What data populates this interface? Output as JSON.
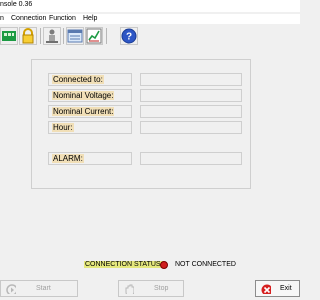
{
  "window": {
    "title": "nsole 0.36"
  },
  "menu": {
    "items": [
      {
        "label": "n"
      },
      {
        "label": "Connection"
      },
      {
        "label": "Function"
      },
      {
        "label": "Help"
      }
    ]
  },
  "toolbar": {
    "buttons": [
      {
        "icon": "green-network-icon"
      },
      {
        "icon": "lock-icon"
      },
      {
        "icon": "person-transfer-icon"
      },
      {
        "icon": "panel-icon"
      },
      {
        "icon": "chart-icon"
      },
      {
        "icon": "help-icon"
      }
    ]
  },
  "fields": {
    "connected_to": {
      "label": "Connected to:",
      "value": ""
    },
    "nominal_voltage": {
      "label": "Nominal Voltage:",
      "value": ""
    },
    "nominal_current": {
      "label": "Nominal Current:",
      "value": ""
    },
    "hour": {
      "label": "Hour:",
      "value": ""
    },
    "alarm": {
      "label": "ALARM:",
      "value": ""
    }
  },
  "status": {
    "label": "CONNECTION STATUS:",
    "value": "NOT CONNECTED",
    "indicator_color": "#cf1e1e"
  },
  "buttons": {
    "start": "Start",
    "stop": "Stop",
    "exit": "Exit"
  }
}
